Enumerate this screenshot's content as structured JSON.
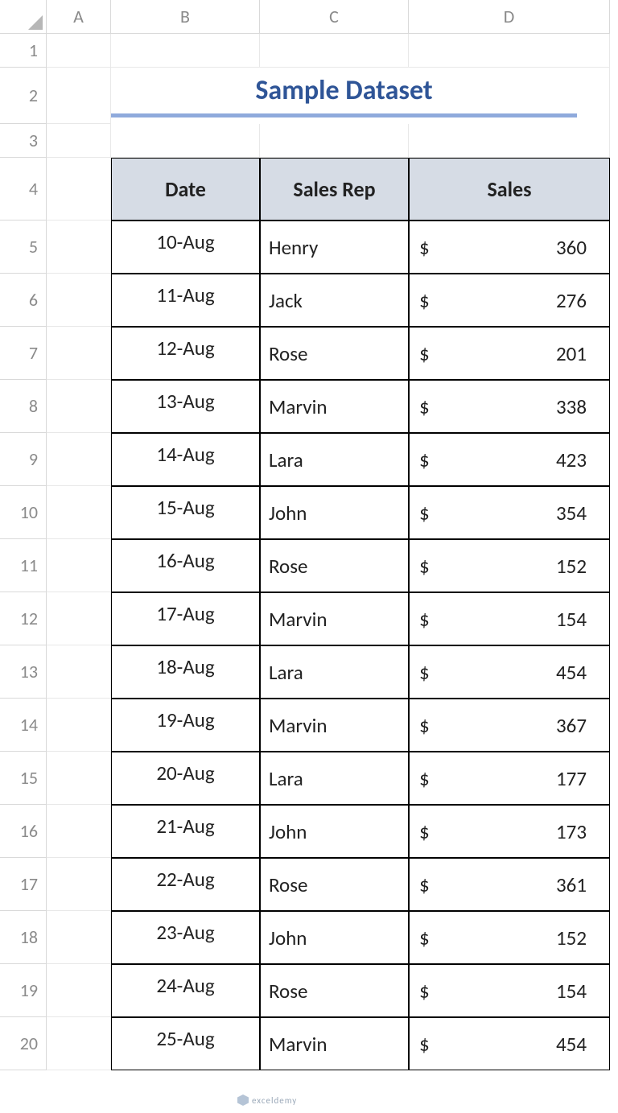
{
  "columns": [
    "A",
    "B",
    "C",
    "D"
  ],
  "rowNumbers": [
    "1",
    "2",
    "3",
    "4",
    "5",
    "6",
    "7",
    "8",
    "9",
    "10",
    "11",
    "12",
    "13",
    "14",
    "15",
    "16",
    "17",
    "18",
    "19",
    "20"
  ],
  "title": "Sample Dataset",
  "headers": {
    "date": "Date",
    "rep": "Sales Rep",
    "sales": "Sales"
  },
  "currency": "$",
  "rows": [
    {
      "date": "10-Aug",
      "rep": "Henry",
      "sales": "360"
    },
    {
      "date": "11-Aug",
      "rep": "Jack",
      "sales": "276"
    },
    {
      "date": "12-Aug",
      "rep": "Rose",
      "sales": "201"
    },
    {
      "date": "13-Aug",
      "rep": "Marvin",
      "sales": "338"
    },
    {
      "date": "14-Aug",
      "rep": "Lara",
      "sales": "423"
    },
    {
      "date": "15-Aug",
      "rep": "John",
      "sales": "354"
    },
    {
      "date": "16-Aug",
      "rep": "Rose",
      "sales": "152"
    },
    {
      "date": "17-Aug",
      "rep": "Marvin",
      "sales": "154"
    },
    {
      "date": "18-Aug",
      "rep": "Lara",
      "sales": "454"
    },
    {
      "date": "19-Aug",
      "rep": "Marvin",
      "sales": "367"
    },
    {
      "date": "20-Aug",
      "rep": "Lara",
      "sales": "177"
    },
    {
      "date": "21-Aug",
      "rep": "John",
      "sales": "173"
    },
    {
      "date": "22-Aug",
      "rep": "Rose",
      "sales": "361"
    },
    {
      "date": "23-Aug",
      "rep": "John",
      "sales": "152"
    },
    {
      "date": "24-Aug",
      "rep": "Rose",
      "sales": "154"
    },
    {
      "date": "25-Aug",
      "rep": "Marvin",
      "sales": "454"
    }
  ],
  "watermark": "exceldemy"
}
